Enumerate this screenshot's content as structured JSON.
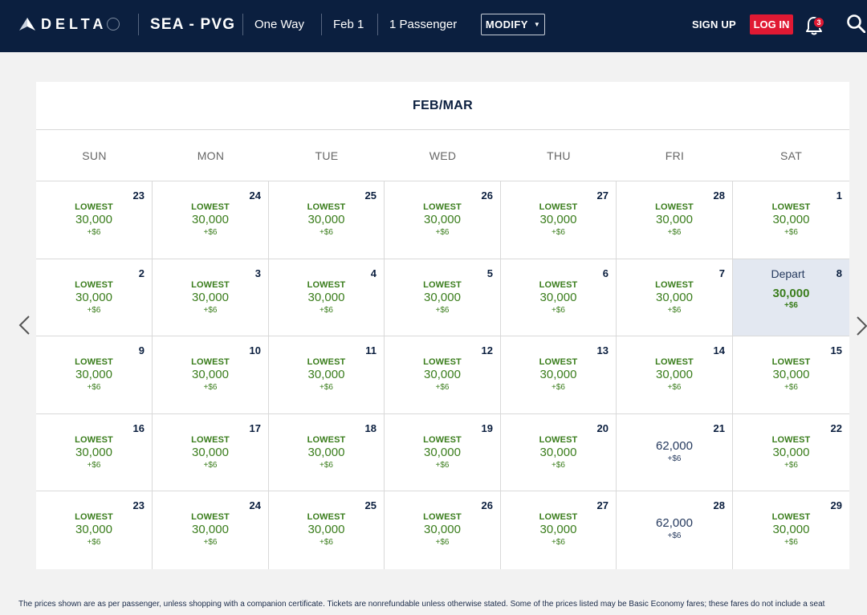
{
  "header": {
    "brand": "DELTA",
    "route": "SEA - PVG",
    "trip_type": "One Way",
    "date": "Feb 1",
    "passengers": "1 Passenger",
    "modify_label": "MODIFY",
    "signup_label": "SIGN UP",
    "login_label": "LOG IN",
    "notification_count": "3",
    "colors": {
      "bar": "#0b1f3f",
      "login": "#e01933"
    },
    "icons": [
      "delta-widget-icon",
      "bell-icon",
      "search-icon",
      "caret-down-icon"
    ]
  },
  "calendar": {
    "title": "FEB/MAR",
    "days_of_week": [
      "SUN",
      "MON",
      "TUE",
      "WED",
      "THU",
      "FRI",
      "SAT"
    ],
    "lowest_label": "LOWEST",
    "depart_label": "Depart",
    "colors": {
      "lowest": "#3a7d1c",
      "regular": "#263a5e",
      "selected_bg": "#e3e8f1"
    },
    "weeks": [
      [
        {
          "day": "23",
          "type": "lowest",
          "miles": "30,000",
          "tax": "+$6"
        },
        {
          "day": "24",
          "type": "lowest",
          "miles": "30,000",
          "tax": "+$6"
        },
        {
          "day": "25",
          "type": "lowest",
          "miles": "30,000",
          "tax": "+$6"
        },
        {
          "day": "26",
          "type": "lowest",
          "miles": "30,000",
          "tax": "+$6"
        },
        {
          "day": "27",
          "type": "lowest",
          "miles": "30,000",
          "tax": "+$6"
        },
        {
          "day": "28",
          "type": "lowest",
          "miles": "30,000",
          "tax": "+$6"
        },
        {
          "day": "1",
          "type": "lowest",
          "miles": "30,000",
          "tax": "+$6"
        }
      ],
      [
        {
          "day": "2",
          "type": "lowest",
          "miles": "30,000",
          "tax": "+$6"
        },
        {
          "day": "3",
          "type": "lowest",
          "miles": "30,000",
          "tax": "+$6"
        },
        {
          "day": "4",
          "type": "lowest",
          "miles": "30,000",
          "tax": "+$6"
        },
        {
          "day": "5",
          "type": "lowest",
          "miles": "30,000",
          "tax": "+$6"
        },
        {
          "day": "6",
          "type": "lowest",
          "miles": "30,000",
          "tax": "+$6"
        },
        {
          "day": "7",
          "type": "lowest",
          "miles": "30,000",
          "tax": "+$6"
        },
        {
          "day": "8",
          "type": "selected",
          "miles": "30,000",
          "tax": "+$6"
        }
      ],
      [
        {
          "day": "9",
          "type": "lowest",
          "miles": "30,000",
          "tax": "+$6"
        },
        {
          "day": "10",
          "type": "lowest",
          "miles": "30,000",
          "tax": "+$6"
        },
        {
          "day": "11",
          "type": "lowest",
          "miles": "30,000",
          "tax": "+$6"
        },
        {
          "day": "12",
          "type": "lowest",
          "miles": "30,000",
          "tax": "+$6"
        },
        {
          "day": "13",
          "type": "lowest",
          "miles": "30,000",
          "tax": "+$6"
        },
        {
          "day": "14",
          "type": "lowest",
          "miles": "30,000",
          "tax": "+$6"
        },
        {
          "day": "15",
          "type": "lowest",
          "miles": "30,000",
          "tax": "+$6"
        }
      ],
      [
        {
          "day": "16",
          "type": "lowest",
          "miles": "30,000",
          "tax": "+$6"
        },
        {
          "day": "17",
          "type": "lowest",
          "miles": "30,000",
          "tax": "+$6"
        },
        {
          "day": "18",
          "type": "lowest",
          "miles": "30,000",
          "tax": "+$6"
        },
        {
          "day": "19",
          "type": "lowest",
          "miles": "30,000",
          "tax": "+$6"
        },
        {
          "day": "20",
          "type": "lowest",
          "miles": "30,000",
          "tax": "+$6"
        },
        {
          "day": "21",
          "type": "regular",
          "miles": "62,000",
          "tax": "+$6"
        },
        {
          "day": "22",
          "type": "lowest",
          "miles": "30,000",
          "tax": "+$6"
        }
      ],
      [
        {
          "day": "23",
          "type": "lowest",
          "miles": "30,000",
          "tax": "+$6"
        },
        {
          "day": "24",
          "type": "lowest",
          "miles": "30,000",
          "tax": "+$6"
        },
        {
          "day": "25",
          "type": "lowest",
          "miles": "30,000",
          "tax": "+$6"
        },
        {
          "day": "26",
          "type": "lowest",
          "miles": "30,000",
          "tax": "+$6"
        },
        {
          "day": "27",
          "type": "lowest",
          "miles": "30,000",
          "tax": "+$6"
        },
        {
          "day": "28",
          "type": "regular",
          "miles": "62,000",
          "tax": "+$6"
        },
        {
          "day": "29",
          "type": "lowest",
          "miles": "30,000",
          "tax": "+$6"
        }
      ]
    ],
    "nav_icons": [
      "chevron-left-icon",
      "chevron-right-icon"
    ]
  },
  "footnote": {
    "text": "The prices shown are as per passenger, unless shopping with a companion certificate. Tickets are nonrefundable unless otherwise stated. Some of the prices listed may be Basic Economy fares; these fares do not include a seat"
  }
}
